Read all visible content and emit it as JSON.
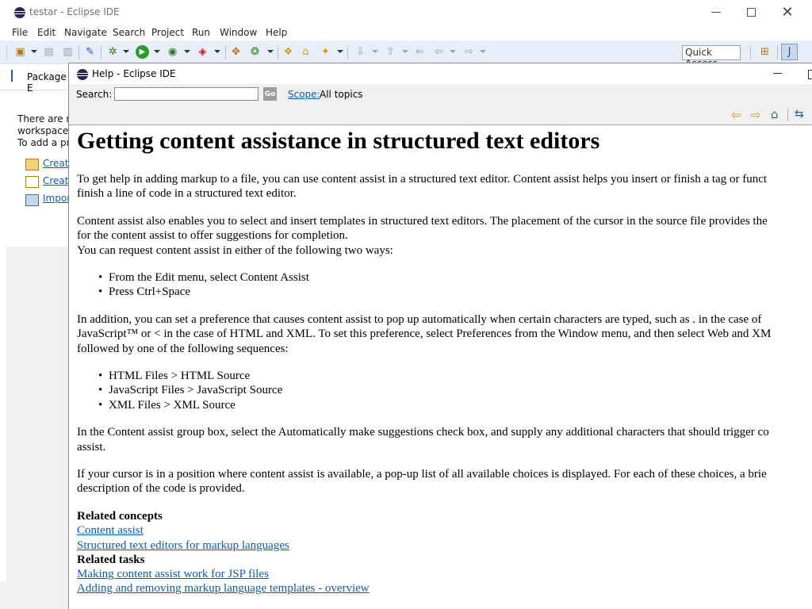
{
  "main_window": {
    "title": "testar - Eclipse IDE",
    "menu": [
      "File",
      "Edit",
      "Navigate",
      "Search",
      "Project",
      "Run",
      "Window",
      "Help"
    ],
    "quick_access": "Quick Access"
  },
  "left_panel": {
    "tab_label": "Package E",
    "msg1": "There are no",
    "msg2": "workspace.",
    "msg3": "To add a pro",
    "links": [
      "Create",
      "Create",
      "Impor"
    ]
  },
  "help_window": {
    "title": "Help - Eclipse IDE",
    "search_label": "Search:",
    "search_value": "",
    "go_label": "Go",
    "scope_label": "Scope:",
    "scope_value": "All topics",
    "heading": "Getting content assistance in structured text editors",
    "p1_l1": "To get help in adding markup to a file, you can use content assist in a structured text editor. Content assist helps you insert or finish a tag or funct",
    "p1_l2": "finish a line of code in a structured text editor.",
    "p2_l1": "Content assist also enables you to select and insert templates in structured text editors. The placement of the cursor in the source file provides the",
    "p2_l2": "for the content assist to offer suggestions for completion.",
    "p2_l3": "You can request content assist in either of the following two ways:",
    "ways": [
      "From the Edit menu, select Content Assist",
      "Press Ctrl+Space"
    ],
    "p3_l1": "In addition, you can set a preference that causes content assist to pop up automatically when certain characters are typed, such as . in the case of",
    "p3_l2": "JavaScript™ or < in the case of HTML and XML. To set this preference, select Preferences from the Window menu, and then select Web and XM",
    "p3_l3": "followed by one of the following sequences:",
    "sequences": [
      "HTML Files > HTML Source",
      "JavaScript Files > JavaScript Source",
      "XML Files > XML Source"
    ],
    "p4_l1": "In the Content assist group box, select the Automatically make suggestions check box, and supply any additional characters that should trigger co",
    "p4_l2": "assist.",
    "p5_l1": "If your cursor is in a position where content assist is available, a pop-up list of all available choices is displayed. For each of these choices, a brie",
    "p5_l2": "description of the code is provided.",
    "related_concepts_label": "Related concepts",
    "related_concepts": [
      "Content assist",
      "Structured text editors for markup languages"
    ],
    "related_tasks_label": "Related tasks",
    "related_tasks": [
      "Making content assist work for JSP files",
      "Adding and removing markup language templates - overview"
    ]
  }
}
